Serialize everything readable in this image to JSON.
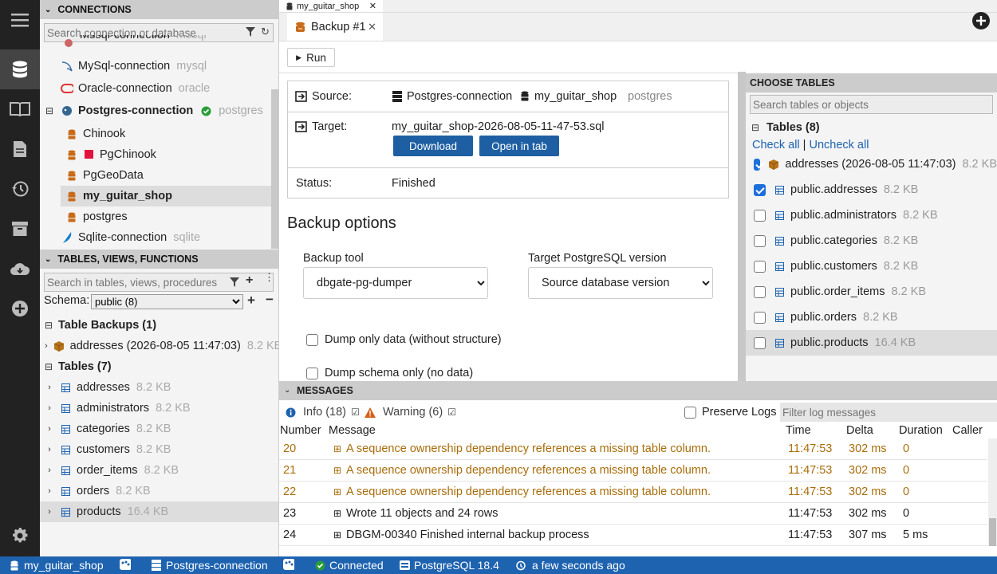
{
  "connections": {
    "header": "CONNECTIONS",
    "search_placeholder": "Search connection or database",
    "items": [
      {
        "name": "Mssql-connection",
        "engine": "mssql"
      },
      {
        "name": "MySql-connection",
        "engine": "mysql"
      },
      {
        "name": "Oracle-connection",
        "engine": "oracle"
      },
      {
        "name": "Postgres-connection",
        "engine": "postgres"
      },
      {
        "name": "Sqlite-connection",
        "engine": "sqlite"
      }
    ],
    "databases": [
      "Chinook",
      "PgChinook",
      "PgGeoData",
      "my_guitar_shop",
      "postgres"
    ]
  },
  "tables_panel": {
    "header": "TABLES, VIEWS, FUNCTIONS",
    "search_placeholder": "Search in tables, views, procedures",
    "schema_label": "Schema:",
    "schema_value": "public (8)",
    "backups_group": "Table Backups (1)",
    "backups": [
      {
        "name": "addresses (2026-08-05 11:47:03)",
        "size": "8.2 KB"
      }
    ],
    "tables_group": "Tables (7)",
    "tables": [
      {
        "name": "addresses",
        "size": "8.2 KB"
      },
      {
        "name": "administrators",
        "size": "8.2 KB"
      },
      {
        "name": "categories",
        "size": "8.2 KB"
      },
      {
        "name": "customers",
        "size": "8.2 KB"
      },
      {
        "name": "order_items",
        "size": "8.2 KB"
      },
      {
        "name": "orders",
        "size": "8.2 KB"
      },
      {
        "name": "products",
        "size": "16.4 KB"
      }
    ]
  },
  "tabs": {
    "small_tab": "my_guitar_shop",
    "main_tab": "Backup #1"
  },
  "main": {
    "run_label": "Run",
    "source_label": "Source:",
    "source_conn": "Postgres-connection",
    "source_db": "my_guitar_shop",
    "source_engine": "postgres",
    "target_label": "Target:",
    "target_file": "my_guitar_shop-2026-08-05-11-47-53.sql",
    "download_label": "Download",
    "open_tab_label": "Open in tab",
    "status_label": "Status:",
    "status_value": "Finished",
    "options_title": "Backup options",
    "tool_label": "Backup tool",
    "tool_value": "dbgate-pg-dumper",
    "version_label": "Target PostgreSQL version",
    "version_value": "Source database version",
    "opt1": "Dump only data (without structure)",
    "opt2": "Dump schema only (no data)"
  },
  "choose": {
    "header": "CHOOSE TABLES",
    "search_placeholder": "Search tables or objects",
    "group": "Tables (8)",
    "check_all": "Check all",
    "sep": "|",
    "uncheck_all": "Uncheck all",
    "items": [
      {
        "name": "addresses (2026-08-05 11:47:03)",
        "size": "8.2 KB",
        "checked": true
      },
      {
        "name": "public.addresses",
        "size": "8.2 KB",
        "checked": true
      },
      {
        "name": "public.administrators",
        "size": "8.2 KB",
        "checked": false
      },
      {
        "name": "public.categories",
        "size": "8.2 KB",
        "checked": false
      },
      {
        "name": "public.customers",
        "size": "8.2 KB",
        "checked": false
      },
      {
        "name": "public.order_items",
        "size": "8.2 KB",
        "checked": false
      },
      {
        "name": "public.orders",
        "size": "8.2 KB",
        "checked": false
      },
      {
        "name": "public.products",
        "size": "16.4 KB",
        "checked": false
      }
    ]
  },
  "messages": {
    "header": "MESSAGES",
    "info_label": "Info (18)",
    "warning_label": "Warning (6)",
    "preserve_label": "Preserve Logs",
    "filter_placeholder": "Filter log messages",
    "columns": [
      "Number",
      "Message",
      "Time",
      "Delta",
      "Duration",
      "Caller"
    ],
    "rows": [
      {
        "num": "20",
        "msg": "A sequence ownership dependency references a missing table column.",
        "time": "11:47:53",
        "delta": "302 ms",
        "duration": "0",
        "level": "warning"
      },
      {
        "num": "21",
        "msg": "A sequence ownership dependency references a missing table column.",
        "time": "11:47:53",
        "delta": "302 ms",
        "duration": "0",
        "level": "warning"
      },
      {
        "num": "22",
        "msg": "A sequence ownership dependency references a missing table column.",
        "time": "11:47:53",
        "delta": "302 ms",
        "duration": "0",
        "level": "warning"
      },
      {
        "num": "23",
        "msg": "Wrote 11 objects and 24 rows",
        "time": "11:47:53",
        "delta": "302 ms",
        "duration": "0",
        "level": "info"
      },
      {
        "num": "24",
        "msg": "DBGM-00340 Finished internal backup process",
        "time": "11:47:53",
        "delta": "307 ms",
        "duration": "5 ms",
        "level": "info"
      }
    ]
  },
  "status": {
    "db": "my_guitar_shop",
    "conn": "Postgres-connection",
    "connected": "Connected",
    "version": "PostgreSQL 18.4",
    "time": "a few seconds ago"
  },
  "colors": {
    "accent": "#1e63b0",
    "warning": "#a86d0a",
    "connected": "#2a9d3a",
    "oracle": "#d33"
  }
}
